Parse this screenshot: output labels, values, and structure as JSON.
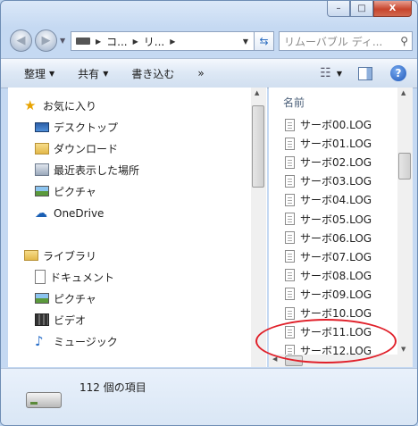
{
  "window": {
    "caption_buttons": [
      "–",
      "□",
      "X"
    ]
  },
  "nav": {
    "back_glyph": "◀",
    "forward_glyph": "▶",
    "address_segments": [
      "コ...",
      "リ..."
    ],
    "search_placeholder": "リムーバブル ディ..."
  },
  "toolbar": {
    "organize": "整理",
    "share": "共有",
    "burn": "書き込む",
    "more": "»"
  },
  "sidebar": {
    "favorites_header": "お気に入り",
    "favorites": [
      {
        "label": "デスクトップ",
        "icon": "desktop-icon"
      },
      {
        "label": "ダウンロード",
        "icon": "downloads-folder-icon"
      },
      {
        "label": "最近表示した場所",
        "icon": "recent-places-icon"
      },
      {
        "label": "ピクチャ",
        "icon": "pictures-icon"
      }
    ],
    "onedrive": "OneDrive",
    "libraries_header": "ライブラリ",
    "libraries": [
      {
        "label": "ドキュメント",
        "icon": "documents-icon"
      },
      {
        "label": "ピクチャ",
        "icon": "pictures-icon"
      },
      {
        "label": "ビデオ",
        "icon": "video-icon"
      },
      {
        "label": "ミュージック",
        "icon": "music-icon"
      }
    ]
  },
  "files": {
    "column_header": "名前",
    "items": [
      "サーボ00.LOG",
      "サーボ01.LOG",
      "サーボ02.LOG",
      "サーボ03.LOG",
      "サーボ04.LOG",
      "サーボ05.LOG",
      "サーボ06.LOG",
      "サーボ07.LOG",
      "サーボ08.LOG",
      "サーボ09.LOG",
      "サーボ10.LOG",
      "サーボ11.LOG",
      "サーボ12.LOG"
    ]
  },
  "details": {
    "item_count": "112 個の項目"
  },
  "colors": {
    "annotation": "#e0202a",
    "help": "#1e57b8"
  }
}
